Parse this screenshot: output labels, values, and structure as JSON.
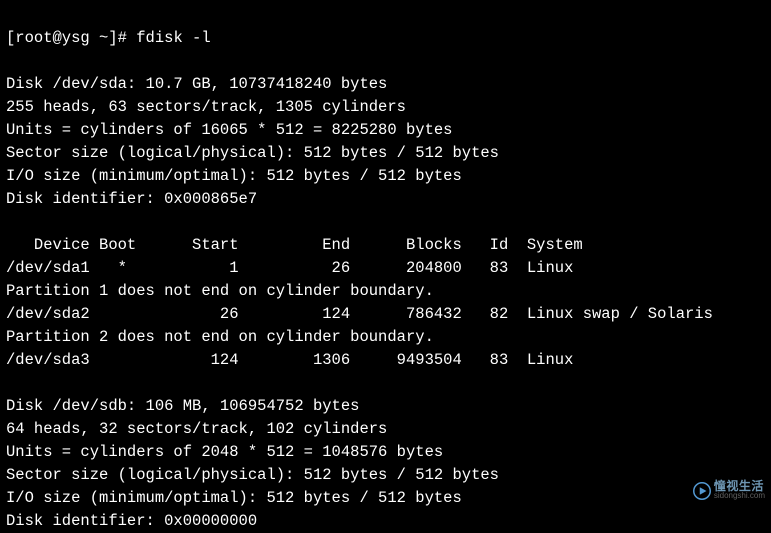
{
  "prompt": {
    "left": "[root@ysg ~]# ",
    "command": "fdisk -l"
  },
  "disk_sda": {
    "header": "Disk /dev/sda: 10.7 GB, 10737418240 bytes",
    "geometry": "255 heads, 63 sectors/track, 1305 cylinders",
    "units": "Units = cylinders of 16065 * 512 = 8225280 bytes",
    "sector_size": "Sector size (logical/physical): 512 bytes / 512 bytes",
    "io_size": "I/O size (minimum/optimal): 512 bytes / 512 bytes",
    "identifier": "Disk identifier: 0x000865e7"
  },
  "partitions": {
    "header": "   Device Boot      Start         End      Blocks   Id  System",
    "row1": "/dev/sda1   *           1          26      204800   83  Linux",
    "note1": "Partition 1 does not end on cylinder boundary.",
    "row2": "/dev/sda2              26         124      786432   82  Linux swap / Solaris",
    "note2": "Partition 2 does not end on cylinder boundary.",
    "row3": "/dev/sda3             124        1306     9493504   83  Linux"
  },
  "disk_sdb": {
    "header": "Disk /dev/sdb: 106 MB, 106954752 bytes",
    "geometry": "64 heads, 32 sectors/track, 102 cylinders",
    "units": "Units = cylinders of 2048 * 512 = 1048576 bytes",
    "sector_size": "Sector size (logical/physical): 512 bytes / 512 bytes",
    "io_size": "I/O size (minimum/optimal): 512 bytes / 512 bytes",
    "identifier": "Disk identifier: 0x00000000"
  },
  "watermark": {
    "text": "憧视生活",
    "sub": "sidongshi.com"
  }
}
